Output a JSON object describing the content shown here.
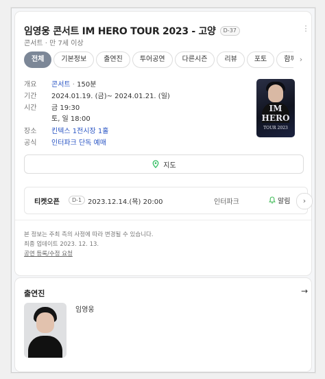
{
  "header": {
    "title": "임영웅 콘서트 IM HERO TOUR 2023 - 고양",
    "dday_badge": "D-37",
    "subtitle": "콘서트 · 만 7세 이상"
  },
  "tabs": [
    {
      "label": "전체",
      "active": true
    },
    {
      "label": "기본정보",
      "active": false
    },
    {
      "label": "출연진",
      "active": false
    },
    {
      "label": "투어공연",
      "active": false
    },
    {
      "label": "다른시즌",
      "active": false
    },
    {
      "label": "리뷰",
      "active": false
    },
    {
      "label": "포토",
      "active": false
    },
    {
      "label": "함께",
      "active": false
    }
  ],
  "info": {
    "overview": {
      "key": "개요",
      "genre": "콘서트",
      "runtime": "150분"
    },
    "period": {
      "key": "기간",
      "value": "2024.01.19. (금)~ 2024.01.21. (일)"
    },
    "time": {
      "key": "시간",
      "line1": "금 19:30",
      "line2": "토, 일 18:00"
    },
    "venue": {
      "key": "장소",
      "value": "킨텍스 1전시장 1홀"
    },
    "official": {
      "key": "공식",
      "value": "인터파크 단독 예매"
    }
  },
  "poster": {
    "line1": "IM",
    "line2": "HERO",
    "line3": "TOUR 2023"
  },
  "map_button": {
    "label": "지도"
  },
  "ticket": {
    "label": "티켓오픈",
    "dday": "D-1",
    "datetime": "2023.12.14.(목) 20:00",
    "vendor": "인터파크",
    "alarm_label": "알림"
  },
  "footer": {
    "notice": "본 정보는 주최 측의 사정에 따라 변경될 수 있습니다.",
    "updated": "최종 업데이트 2023. 12. 13.",
    "report_link": "공연 등록/수정 요청"
  },
  "cast": {
    "title": "출연진",
    "members": [
      {
        "name": "임영웅"
      }
    ]
  },
  "colors": {
    "active_tab": "#7c8797",
    "link": "#2a55c4",
    "alarm_green": "#3cba54",
    "map_pin_green": "#2dbd5f"
  }
}
